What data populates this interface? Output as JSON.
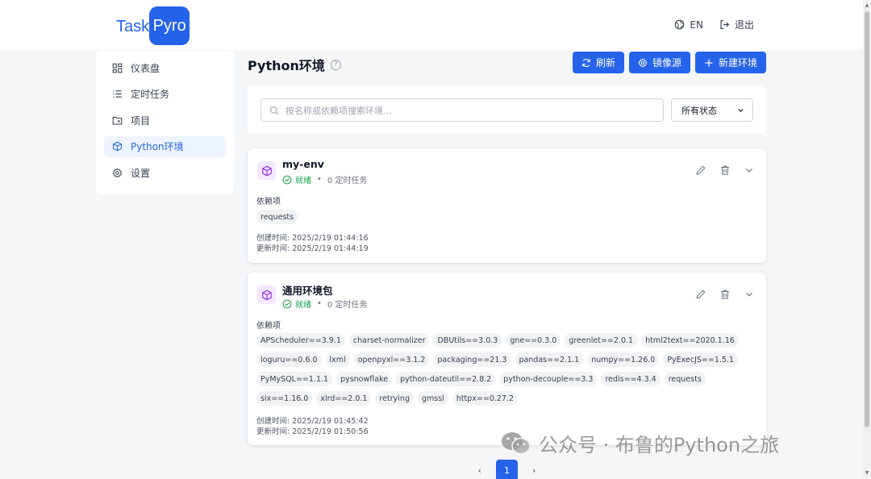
{
  "header": {
    "logo_part1": "Task",
    "logo_part2": "Pyro",
    "lang_label": "EN",
    "logout_label": "退出"
  },
  "sidebar": {
    "items": [
      {
        "label": "仪表盘",
        "icon": "dashboard-icon"
      },
      {
        "label": "定时任务",
        "icon": "list-icon"
      },
      {
        "label": "项目",
        "icon": "folder-icon"
      },
      {
        "label": "Python环境",
        "icon": "cube-icon",
        "active": true
      },
      {
        "label": "设置",
        "icon": "gear-icon"
      }
    ]
  },
  "main": {
    "title": "Python环境",
    "buttons": {
      "refresh": "刷新",
      "mirror": "镜像源",
      "new_env": "新建环境"
    },
    "search_placeholder": "按名称或依赖项搜索环境...",
    "status_select": "所有状态"
  },
  "envs": [
    {
      "name": "my-env",
      "status": "就绪",
      "tasks": "0 定时任务",
      "deps_label": "依赖项",
      "deps": [
        "requests"
      ],
      "created": "创建时间: 2025/2/19 01:44:16",
      "updated": "更新时间: 2025/2/19 01:44:19"
    },
    {
      "name": "通用环境包",
      "status": "就绪",
      "tasks": "0 定时任务",
      "deps_label": "依赖项",
      "deps": [
        "APScheduler==3.9.1",
        "charset-normalizer",
        "DBUtils==3.0.3",
        "gne==0.3.0",
        "greenlet==2.0.1",
        "html2text==2020.1.16",
        "loguru==0.6.0",
        "lxml",
        "openpyxl==3.1.2",
        "packaging==21.3",
        "pandas==2.1.1",
        "numpy==1.26.0",
        "PyExecJS==1.5.1",
        "PyMySQL==1.1.1",
        "pysnowflake",
        "python-dateutil==2.8.2",
        "python-decouple==3.3",
        "redis==4.3.4",
        "requests",
        "six==1.16.0",
        "xlrd==2.0.1",
        "retrying",
        "gmssl",
        "httpx==0.27.2"
      ],
      "created": "创建时间: 2025/2/19 01:45:42",
      "updated": "更新时间: 2025/2/19 01:50:56"
    }
  ],
  "pagination": {
    "current": "1",
    "prev": "‹",
    "next": "›"
  },
  "watermark": "公众号 · 布鲁的Python之旅",
  "colors": {
    "accent": "#2563eb",
    "success": "#16a34a",
    "env_icon": "#9333ea"
  }
}
